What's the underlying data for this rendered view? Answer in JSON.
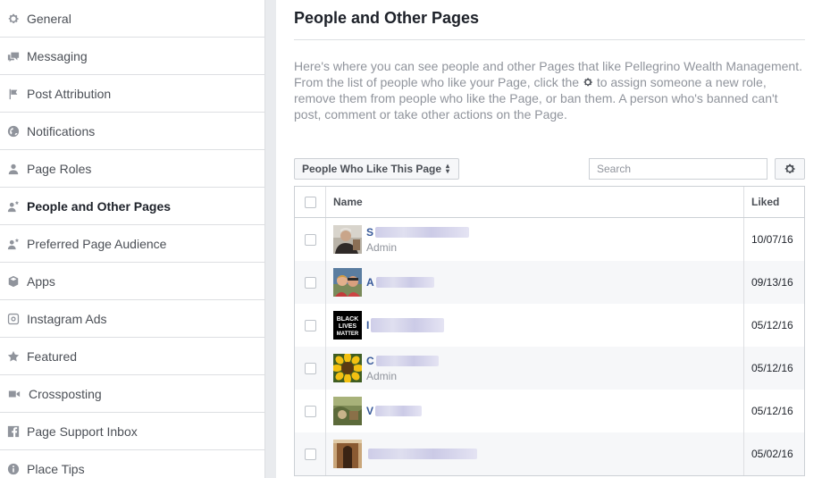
{
  "sidebar": {
    "items": [
      {
        "label": "General",
        "icon": "gear-icon",
        "active": false
      },
      {
        "label": "Messaging",
        "icon": "messaging-icon",
        "active": false
      },
      {
        "label": "Post Attribution",
        "icon": "flag-icon",
        "active": false
      },
      {
        "label": "Notifications",
        "icon": "globe-icon",
        "active": false
      },
      {
        "label": "Page Roles",
        "icon": "person-icon",
        "active": false
      },
      {
        "label": "People and Other Pages",
        "icon": "person-star-icon",
        "active": true
      },
      {
        "label": "Preferred Page Audience",
        "icon": "person-star-icon",
        "active": false
      },
      {
        "label": "Apps",
        "icon": "cube-icon",
        "active": false
      },
      {
        "label": "Instagram Ads",
        "icon": "instagram-icon",
        "active": false
      },
      {
        "label": "Featured",
        "icon": "star-icon",
        "active": false
      },
      {
        "label": "Crossposting",
        "icon": "video-camera-icon",
        "active": false
      },
      {
        "label": "Page Support Inbox",
        "icon": "facebook-icon",
        "active": false
      },
      {
        "label": "Place Tips",
        "icon": "info-icon",
        "active": false
      }
    ]
  },
  "main": {
    "title": "People and Other Pages",
    "description_before_icon": "Here's where you can see people and other Pages that like Pellegrino Wealth Management. From the list of people who like your Page, click the",
    "description_after_icon": "to assign someone a new role, remove them from people who like the Page, or ban them. A person who's banned can't post, comment or take other actions on the Page.",
    "filter_label": "People Who Like This Page",
    "search_placeholder": "Search",
    "table": {
      "col_name": "Name",
      "col_liked": "Liked",
      "rows": [
        {
          "initial": "S",
          "role": "Admin",
          "liked": "10/07/16",
          "avatar": "portrait-photo"
        },
        {
          "initial": "A",
          "role": "",
          "liked": "09/13/16",
          "avatar": "couple-photo"
        },
        {
          "initial": "I",
          "role": "",
          "liked": "05/12/16",
          "avatar": "black-lives-matter-logo"
        },
        {
          "initial": "C",
          "role": "Admin",
          "liked": "05/12/16",
          "avatar": "sunflower-photo"
        },
        {
          "initial": "V",
          "role": "",
          "liked": "05/12/16",
          "avatar": "landscape-photo"
        },
        {
          "initial": "",
          "role": "",
          "liked": "05/02/16",
          "avatar": "building-photo"
        }
      ]
    },
    "blm_logo_text": [
      "BLACK",
      "LIVES",
      "MATTER"
    ]
  },
  "colors": {
    "link": "#365899",
    "muted": "#90949c",
    "border": "#dddfe2"
  }
}
